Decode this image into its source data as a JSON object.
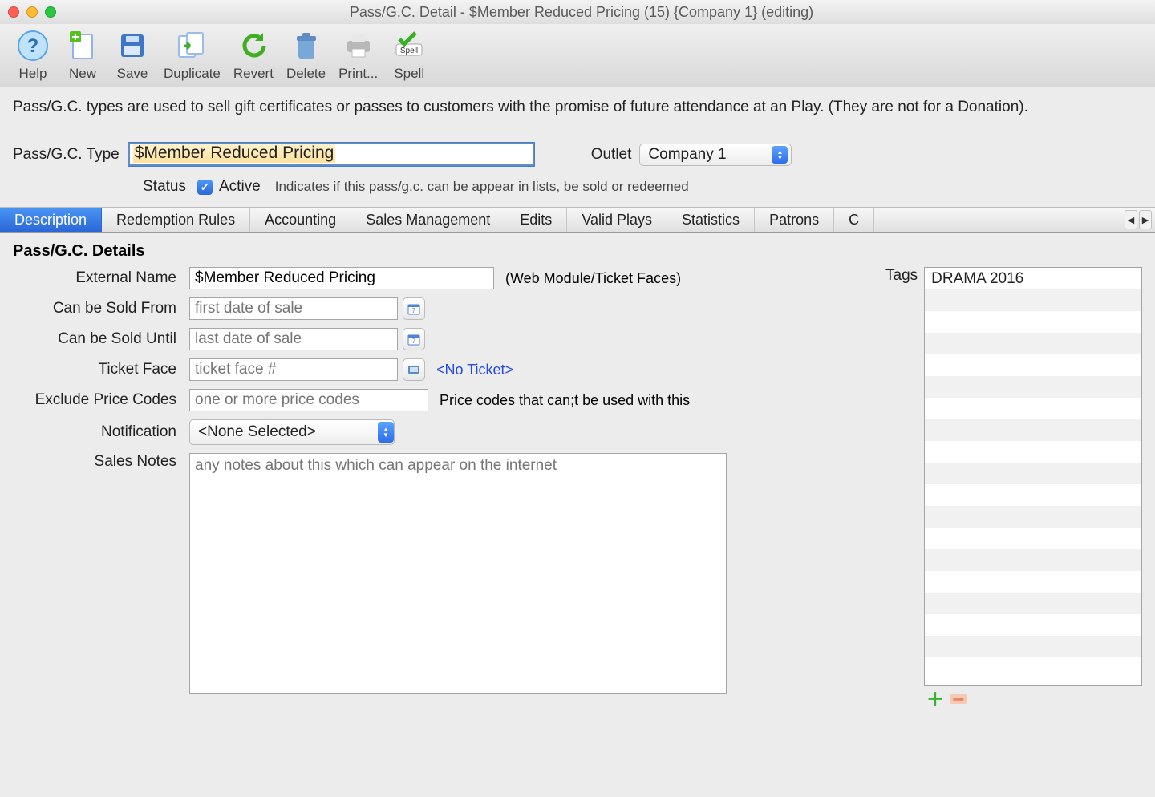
{
  "window": {
    "title": "Pass/G.C. Detail - $Member Reduced Pricing (15) {Company 1} (editing)"
  },
  "toolbar": {
    "help": "Help",
    "new": "New",
    "save": "Save",
    "duplicate": "Duplicate",
    "revert": "Revert",
    "delete": "Delete",
    "print": "Print...",
    "spell": "Spell",
    "spell_badge": "Spell"
  },
  "note": "Pass/G.C. types are used to sell gift certificates or passes to customers with the promise of future attendance at an Play.  (They are not for a Donation).",
  "type": {
    "label": "Pass/G.C. Type",
    "value": "$Member Reduced Pricing"
  },
  "outlet": {
    "label": "Outlet",
    "value": "Company 1"
  },
  "status": {
    "label": "Status",
    "active_label": "Active",
    "checked": true,
    "hint": "Indicates if this pass/g.c. can be appear in lists, be sold or redeemed"
  },
  "tabs": {
    "items": [
      "Description",
      "Redemption Rules",
      "Accounting",
      "Sales Management",
      "Edits",
      "Valid Plays",
      "Statistics",
      "Patrons",
      "C"
    ],
    "active_index": 0
  },
  "details": {
    "heading": "Pass/G.C. Details",
    "external_name": {
      "label": "External Name",
      "value": "$Member Reduced Pricing",
      "note": "(Web Module/Ticket Faces)"
    },
    "sold_from": {
      "label": "Can be Sold From",
      "placeholder": "first date of sale"
    },
    "sold_until": {
      "label": "Can be Sold Until",
      "placeholder": "last date of sale"
    },
    "ticket_face": {
      "label": "Ticket Face",
      "placeholder": "ticket face #",
      "note": "<No Ticket>"
    },
    "exclude_price": {
      "label": "Exclude Price Codes",
      "placeholder": "one or more price codes",
      "note": "Price codes that can;t be used with this"
    },
    "notification": {
      "label": "Notification",
      "value": "<None Selected>"
    },
    "sales_notes": {
      "label": "Sales Notes",
      "placeholder": "any notes about this which can appear on the internet"
    }
  },
  "tags": {
    "label": "Tags",
    "items": [
      "DRAMA 2016"
    ]
  },
  "colors": {
    "tab_active_bg": "#3a7ee6",
    "accent_blue": "#2a67d8"
  }
}
